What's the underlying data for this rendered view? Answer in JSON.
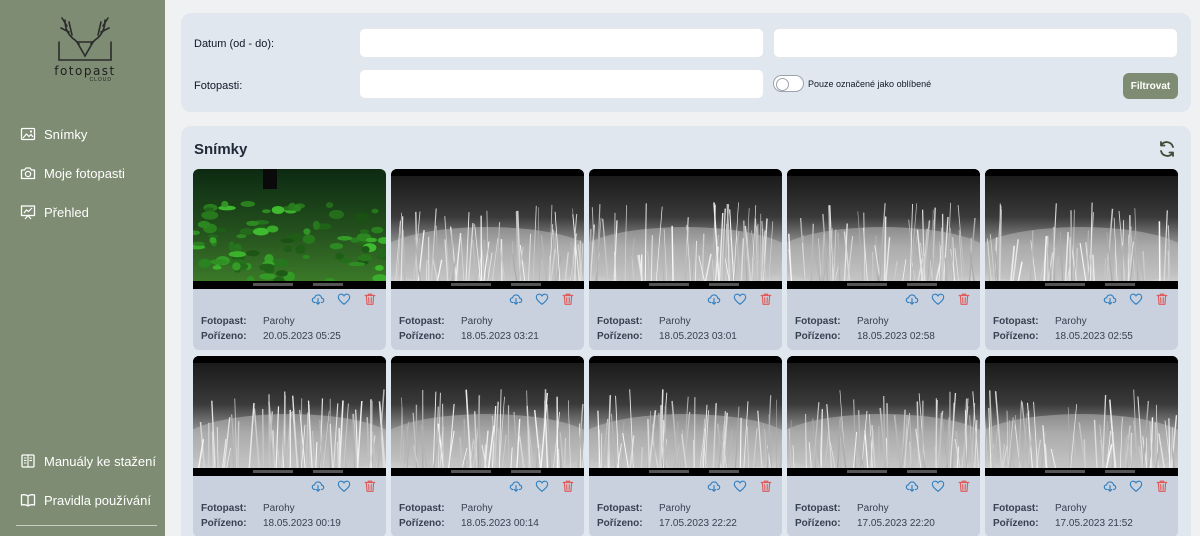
{
  "app": {
    "logo_text": "fotopast",
    "logo_sub": "CLOUD"
  },
  "sidebar": {
    "items": [
      {
        "label": "Snímky",
        "icon": "image-icon"
      },
      {
        "label": "Moje fotopasti",
        "icon": "camera-icon"
      },
      {
        "label": "Přehled",
        "icon": "chart-board-icon"
      }
    ],
    "bottom_items": [
      {
        "label": "Manuály ke stažení",
        "icon": "book-open-icon"
      },
      {
        "label": "Pravidla používání",
        "icon": "book-icon"
      }
    ]
  },
  "filter": {
    "date_label": "Datum (od - do):",
    "date_from_value": "",
    "date_to_value": "",
    "camera_label": "Fotopasti:",
    "camera_value": "",
    "favorites_toggle_label": "Pouze označené jako oblíbené",
    "favorites_only": false,
    "filter_button": "Filtrovat"
  },
  "gallery": {
    "title": "Snímky",
    "camera_key": "Fotopast:",
    "taken_key": "Pořízeno:",
    "photos": [
      {
        "camera": "Parohy",
        "taken": "20.05.2023 05:25",
        "mode": "day"
      },
      {
        "camera": "Parohy",
        "taken": "18.05.2023 03:21",
        "mode": "night"
      },
      {
        "camera": "Parohy",
        "taken": "18.05.2023 03:01",
        "mode": "night"
      },
      {
        "camera": "Parohy",
        "taken": "18.05.2023 02:58",
        "mode": "night"
      },
      {
        "camera": "Parohy",
        "taken": "18.05.2023 02:55",
        "mode": "night"
      },
      {
        "camera": "Parohy",
        "taken": "18.05.2023 00:19",
        "mode": "night"
      },
      {
        "camera": "Parohy",
        "taken": "18.05.2023 00:14",
        "mode": "night"
      },
      {
        "camera": "Parohy",
        "taken": "17.05.2023 22:22",
        "mode": "night"
      },
      {
        "camera": "Parohy",
        "taken": "17.05.2023 22:20",
        "mode": "night"
      },
      {
        "camera": "Parohy",
        "taken": "17.05.2023 21:52",
        "mode": "night"
      }
    ]
  },
  "colors": {
    "sidebar": "#7d8c72",
    "panel": "#e1e7ef",
    "card": "#c8d1dd",
    "download_icon": "#2f7fc1",
    "favorite_icon": "#2f7fc1",
    "delete_icon": "#e05a5a"
  }
}
